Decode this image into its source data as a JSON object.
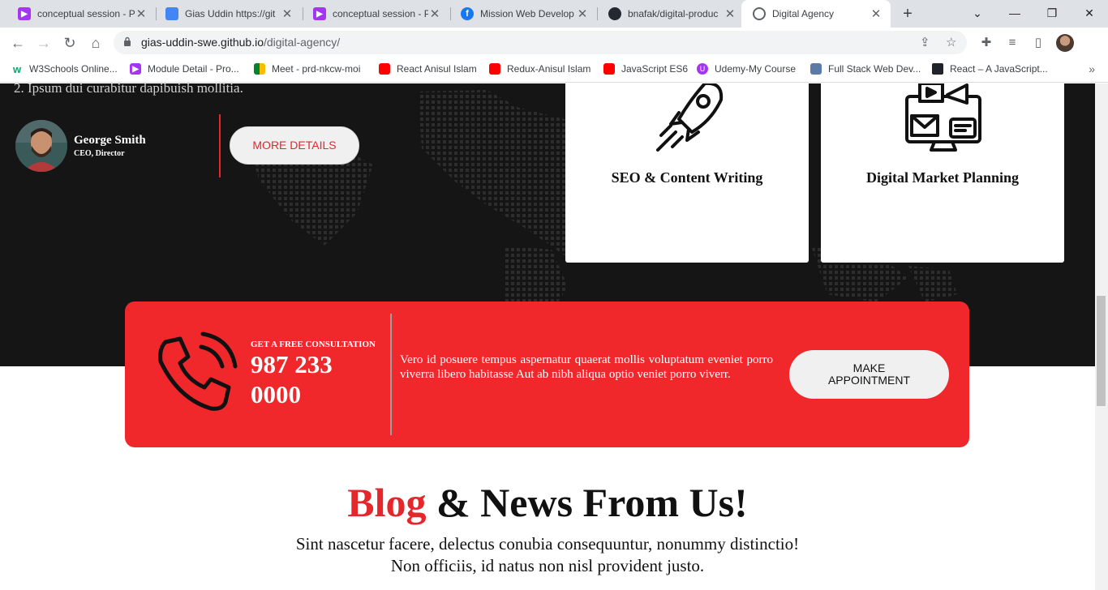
{
  "browser": {
    "tabs": [
      {
        "title": "conceptual session - P",
        "icon": "udemy-icon"
      },
      {
        "title": "Gias Uddin https://git",
        "icon": "docs-icon"
      },
      {
        "title": "conceptual session - P",
        "icon": "udemy-icon"
      },
      {
        "title": "Mission Web Develop",
        "icon": "facebook-icon"
      },
      {
        "title": "bnafak/digital-produc",
        "icon": "github-icon"
      },
      {
        "title": "Digital Agency",
        "icon": "globe-icon"
      }
    ],
    "address": {
      "domain": "gias-uddin-swe.github.io",
      "path": "/digital-agency/"
    },
    "bookmarks": [
      "W3Schools Online...",
      "Module Detail - Pro...",
      "Meet - prd-nkcw-moi",
      "React Anisul Islam",
      "Redux-Anisul Islam",
      "JavaScript ES6",
      "Udemy-My Course",
      "Full Stack Web Dev...",
      "React – A JavaScript..."
    ]
  },
  "testimonial": {
    "list_item": "2. Ipsum dui curabitur dapibuish mollitia.",
    "name": "George Smith",
    "role": "CEO, Director",
    "button": "MORE DETAILS"
  },
  "services": [
    {
      "title": "SEO & Content Writing",
      "icon": "rocket-icon"
    },
    {
      "title": "Digital Market Planning",
      "icon": "marketing-screen-icon"
    }
  ],
  "consultation": {
    "kicker": "GET A FREE CONSULTATION",
    "phone": "987 233 0000",
    "text": "Vero id posuere tempus aspernatur quaerat mollis voluptatum eveniet porro viverra libero habitasse Aut ab nibh aliqua optio veniet porro viverr.",
    "button": "MAKE APPOINTMENT"
  },
  "blog": {
    "title_accent": "Blog",
    "title_rest": " & News From Us!",
    "subtitle_line1": "Sint nascetur facere, delectus conubia consequuntur, nonummy distinctio!",
    "subtitle_line2": "Non officiis, id natus non nisl provident justo."
  },
  "colors": {
    "accent": "#e5262b",
    "dark_bg": "#151515",
    "banner": "#f0282c"
  }
}
